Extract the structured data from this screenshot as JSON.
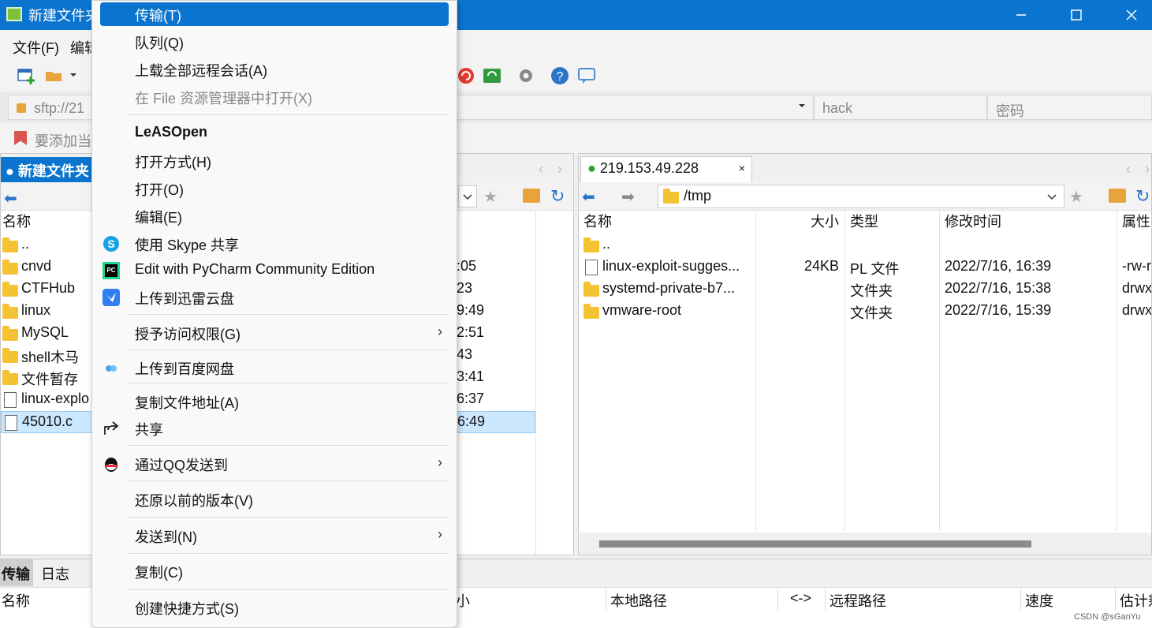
{
  "window": {
    "title": "新建文件夹"
  },
  "menubar": {
    "items": [
      "文件(F)",
      "编辑"
    ]
  },
  "address": {
    "host": "sftp://21",
    "user": "hack",
    "password_placeholder": "密码"
  },
  "bookmark": {
    "hint": "要添加当"
  },
  "local": {
    "tab": "新建文件夹",
    "col_name": "名称",
    "rows": [
      {
        "name": "..",
        "type": "up",
        "time": ""
      },
      {
        "name": "cnvd",
        "type": "folder",
        "time": ":05"
      },
      {
        "name": "CTFHub",
        "type": "folder",
        "time": "23"
      },
      {
        "name": "linux",
        "type": "folder",
        "time": "9:49"
      },
      {
        "name": "MySQL",
        "type": "folder",
        "time": "2:51"
      },
      {
        "name": "shell木马",
        "type": "folder",
        "time": "43"
      },
      {
        "name": "文件暂存",
        "type": "folder-link",
        "time": "3:41"
      },
      {
        "name": "linux-explo",
        "type": "file",
        "time": "6:37"
      },
      {
        "name": "45010.c",
        "type": "file",
        "time": "6:49",
        "selected": true
      }
    ]
  },
  "remote": {
    "tab": "219.153.49.228",
    "path": "/tmp",
    "cols": {
      "name": "名称",
      "size": "大小",
      "type": "类型",
      "mtime": "修改时间",
      "attr": "属性"
    },
    "rows": [
      {
        "name": "..",
        "size": "",
        "type": "",
        "mtime": "",
        "attr": "",
        "kind": "up"
      },
      {
        "name": "linux-exploit-sugges...",
        "size": "24KB",
        "type": "PL 文件",
        "mtime": "2022/7/16, 16:39",
        "attr": "-rw-r",
        "kind": "file"
      },
      {
        "name": "systemd-private-b7...",
        "size": "",
        "type": "文件夹",
        "mtime": "2022/7/16, 15:38",
        "attr": "drwx",
        "kind": "folder"
      },
      {
        "name": "vmware-root",
        "size": "",
        "type": "文件夹",
        "mtime": "2022/7/16, 15:39",
        "attr": "drwx",
        "kind": "folder"
      }
    ]
  },
  "queue": {
    "tabs": [
      "传输",
      "日志"
    ],
    "cols": [
      "名称",
      "小",
      "本地路径",
      "<->",
      "远程路径",
      "速度",
      "估计剩"
    ]
  },
  "watermark": "CSDN @sGanYu",
  "context_menu": {
    "items": [
      {
        "label": "传输(T)",
        "state": "highlighted"
      },
      {
        "label": "队列(Q)"
      },
      {
        "label": "上载全部远程会话(A)"
      },
      {
        "label": "在 File 资源管理器中打开(X)",
        "state": "disabled"
      },
      {
        "label": "LeASOpen",
        "bold": true
      },
      {
        "label": "打开方式(H)"
      },
      {
        "label": "打开(O)"
      },
      {
        "label": "编辑(E)"
      },
      {
        "label": "使用 Skype 共享",
        "icon": "skype-icon"
      },
      {
        "label": "Edit with PyCharm Community Edition",
        "icon": "pycharm-icon"
      },
      {
        "label": "上传到迅雷云盘",
        "icon": "thunder-icon"
      },
      {
        "label": "授予访问权限(G)",
        "submenu": true
      },
      {
        "label": "上传到百度网盘",
        "icon": "baidu-netdisk-icon"
      },
      {
        "label": "复制文件地址(A)"
      },
      {
        "label": "共享",
        "icon": "share-icon"
      },
      {
        "label": "通过QQ发送到",
        "icon": "qq-icon",
        "submenu": true
      },
      {
        "label": "还原以前的版本(V)"
      },
      {
        "label": "发送到(N)",
        "submenu": true
      },
      {
        "label": "复制(C)"
      },
      {
        "label": "创建快捷方式(S)"
      }
    ]
  },
  "colors": {
    "accent": "#0a74cf",
    "selection": "#cce8ff",
    "folder": "#f5c233"
  }
}
